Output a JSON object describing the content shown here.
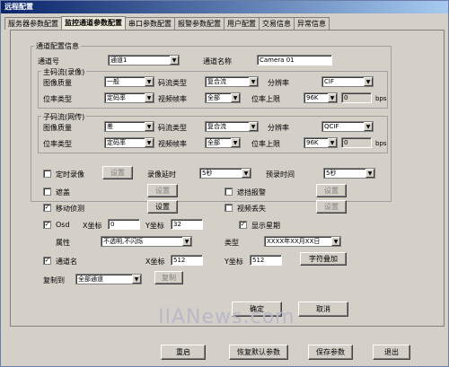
{
  "window": {
    "title": "远程配置"
  },
  "tabs": [
    "服务器参数配置",
    "监控通道参数配置",
    "串口参数配置",
    "报警参数配置",
    "用户配置",
    "交易信息",
    "异常信息"
  ],
  "channel_group": {
    "title": "通道配置信息",
    "channel_label": "通道号",
    "channel_value": "通道1",
    "name_label": "通道名称",
    "name_value": "Camera 01"
  },
  "main_stream": {
    "title": "主码流(录像)",
    "quality_label": "图像质量",
    "quality_value": "一般",
    "stream_type_label": "码流类型",
    "stream_type_value": "复合流",
    "resolution_label": "分辨率",
    "resolution_value": "CIF",
    "bitrate_type_label": "位率类型",
    "bitrate_type_value": "定码率",
    "framerate_label": "视频帧率",
    "framerate_value": "全部",
    "bitrate_max_label": "位率上限",
    "bitrate_max_value": "96K",
    "bitrate_custom_value": "0",
    "unit": "bps"
  },
  "sub_stream": {
    "title": "子码流(网传)",
    "quality_label": "图像质量",
    "quality_value": "差",
    "stream_type_label": "码流类型",
    "stream_type_value": "复合流",
    "resolution_label": "分辨率",
    "resolution_value": "QCIF",
    "bitrate_type_label": "位率类型",
    "bitrate_type_value": "定码率",
    "framerate_label": "视频帧率",
    "framerate_value": "全部",
    "bitrate_max_label": "位率上限",
    "bitrate_max_value": "96K",
    "bitrate_custom_value": "0",
    "unit": "bps"
  },
  "record": {
    "schedule_label": "定时录像",
    "settings_label": "设置",
    "delay_label": "录像延时",
    "delay_value": "5秒",
    "prerecord_label": "预录时间",
    "prerecord_value": "5秒"
  },
  "mask": {
    "label": "遮盖",
    "settings_label": "设置",
    "alarm_label": "遮挡报警",
    "alarm_settings_label": "设置"
  },
  "motion": {
    "label": "移动侦测",
    "settings_label": "设置",
    "loss_label": "视频丢失",
    "loss_settings_label": "设置"
  },
  "osd": {
    "label": "Osd",
    "x_label": "X坐标",
    "x_value": "0",
    "y_label": "Y坐标",
    "y_value": "32",
    "show_week_label": "显示星期",
    "attr_label": "属性",
    "attr_value": "不透明,不闪烁",
    "type_label": "类型",
    "type_value": "XXXX年XX月XX日"
  },
  "channel_name": {
    "label": "通道名",
    "x_label": "X坐标",
    "x_value": "512",
    "y_label": "Y坐标",
    "y_value": "512",
    "overlay_label": "字符叠加"
  },
  "copy": {
    "label": "复制到",
    "value": "全部通道",
    "button_label": "复制"
  },
  "dialog_buttons": {
    "ok": "确定",
    "cancel": "取消"
  },
  "footer_buttons": {
    "restart": "重启",
    "restore": "恢复默认参数",
    "save": "保存参数",
    "exit": "退出"
  },
  "watermark": "IIANews.com"
}
